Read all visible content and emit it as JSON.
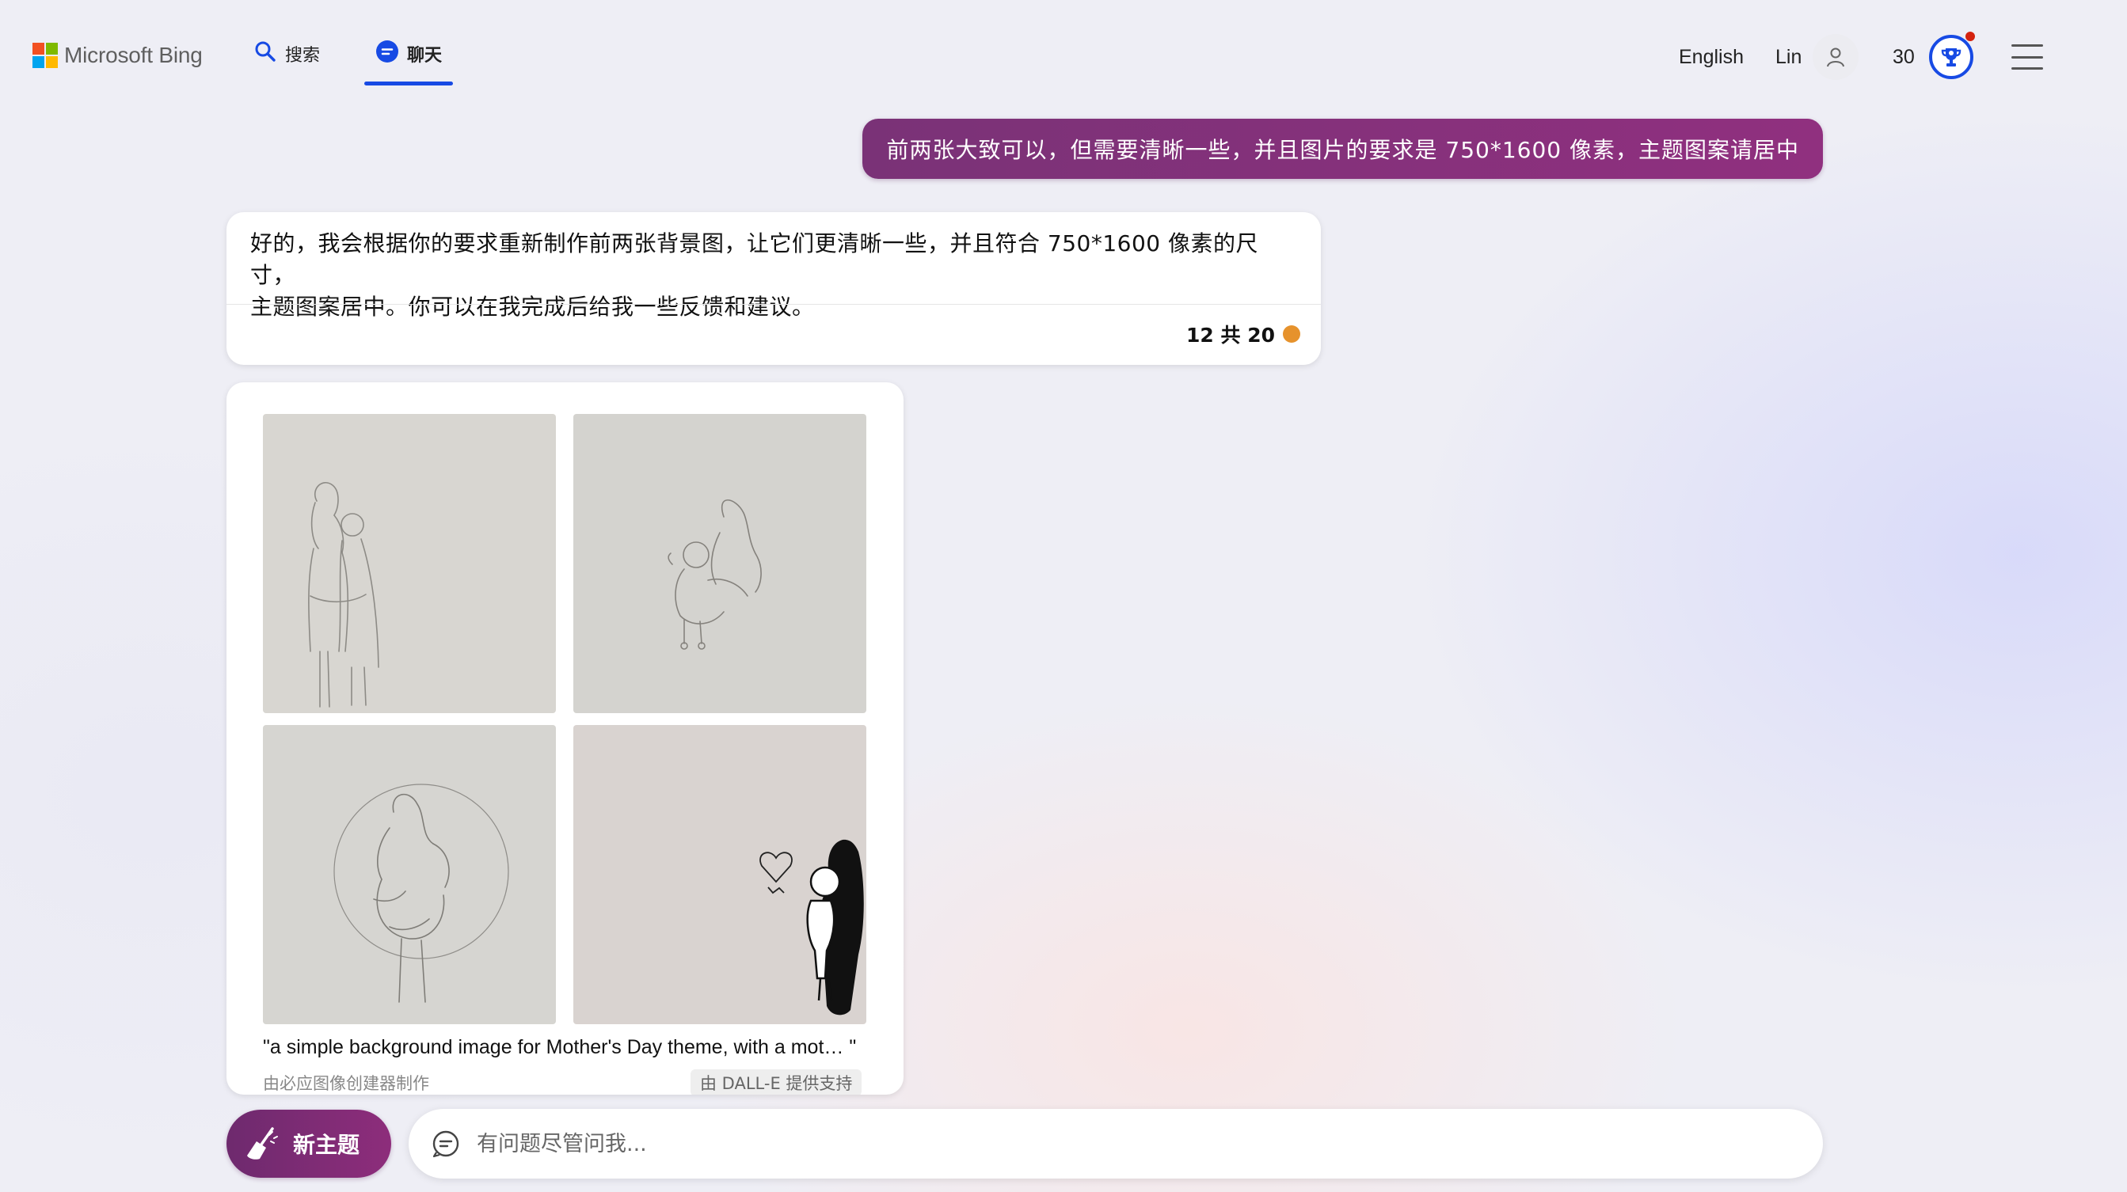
{
  "header": {
    "brand": "Microsoft Bing",
    "tabs": [
      {
        "label": "搜索",
        "icon": "search-icon",
        "active": false
      },
      {
        "label": "聊天",
        "icon": "chat-icon",
        "active": true
      }
    ],
    "language": "English",
    "user_name": "Lin",
    "points": "30",
    "accent_color": "#174ae4"
  },
  "chat": {
    "user_message": "前两张大致可以，但需要清晰一些，并且图片的要求是 750*1600 像素，主题图案请居中",
    "bot_message": {
      "line1": "好的，我会根据你的要求重新制作前两张背景图，让它们更清晰一些，并且符合 750*1600 像素的尺寸，",
      "line2": "主题图案居中。你可以在我完成后给我一些反馈和建议。",
      "turn_counter": "12 共 20"
    },
    "image_card": {
      "caption": "\"a simple background image for Mother's Day theme, with a mot… \"",
      "credit_left": "由必应图像创建器制作",
      "credit_right": "由 DALL-E 提供支持"
    }
  },
  "composer": {
    "new_topic_label": "新主题",
    "placeholder": "有问题尽管问我..."
  }
}
